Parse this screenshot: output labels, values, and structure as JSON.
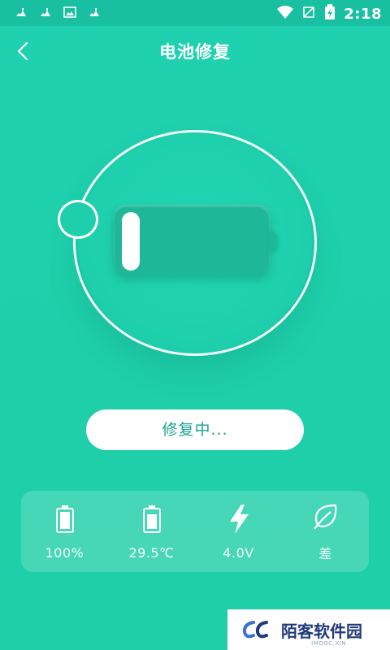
{
  "status_bar": {
    "time": "2:18",
    "left_icons": [
      "notification-icon",
      "notification-icon",
      "image-icon",
      "notification-icon"
    ],
    "right_icons": [
      "wifi-icon",
      "no-sim-icon",
      "battery-charging-icon"
    ]
  },
  "header": {
    "title": "电池修复",
    "back_icon": "back-chevron-icon"
  },
  "battery_graphic": {
    "level_fraction": 0.1
  },
  "action": {
    "label": "修复中..."
  },
  "stats": [
    {
      "icon": "battery-full-icon",
      "value": "100%"
    },
    {
      "icon": "battery-temp-icon",
      "value": "29.5℃"
    },
    {
      "icon": "lightning-icon",
      "value": "4.0V"
    },
    {
      "icon": "leaf-icon",
      "value": "差"
    }
  ],
  "watermark": {
    "text": "陌客软件园",
    "sub": "IMOOC.XIN"
  },
  "colors": {
    "background": "#1fd1b0",
    "status_bar": "#18bfa0",
    "accent_text": "#18a58b",
    "battery_body": "#1eb899"
  }
}
